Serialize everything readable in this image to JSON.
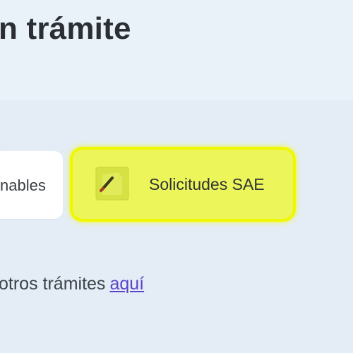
{
  "header": {
    "title": "n trámite"
  },
  "cards": [
    {
      "label": "nables",
      "icon": "",
      "highlighted": false
    },
    {
      "label": "Solicitudes SAE",
      "icon": "note-edit-icon",
      "highlighted": true
    }
  ],
  "footer": {
    "text": "otros trámites",
    "link": "aquí"
  },
  "colors": {
    "highlight": "#f0f800",
    "link": "#5b43c9",
    "header_bg": "#e9f1f9",
    "main_bg": "#e4edf5"
  }
}
